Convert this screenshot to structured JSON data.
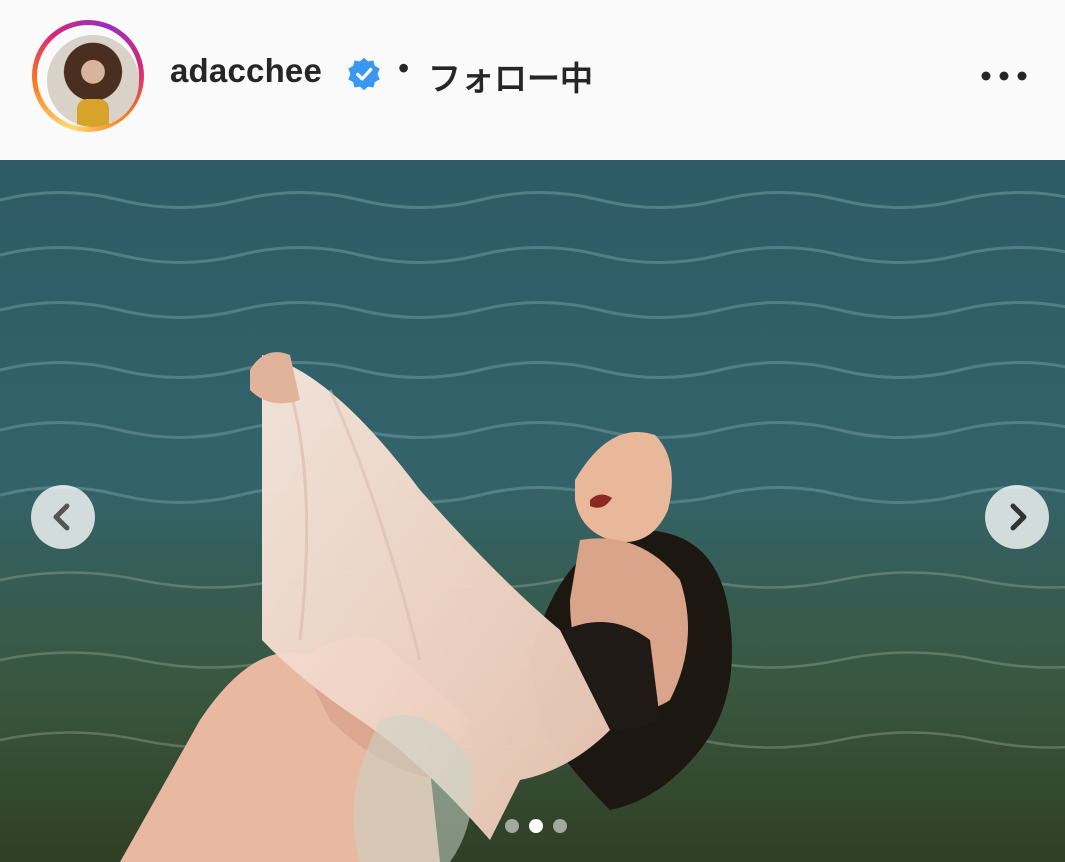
{
  "post_header": {
    "username": "adacchee",
    "separator": "•",
    "follow_status": "フォロー中",
    "verified": true,
    "accent_colors": {
      "verified_blue": "#3897f0",
      "story_ring": [
        "#feda75",
        "#fa7e1e",
        "#d62976",
        "#962fbf"
      ]
    },
    "more_icon": "more-options-icon"
  },
  "carousel": {
    "prev_icon": "chevron-left-icon",
    "next_icon": "chevron-right-icon",
    "total_slides": 3,
    "current_slide": 2
  }
}
